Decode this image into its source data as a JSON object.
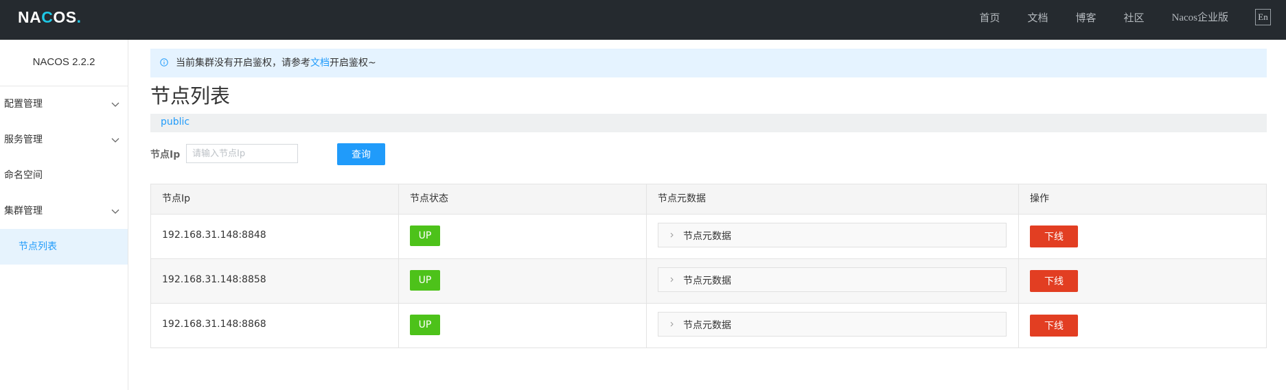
{
  "header": {
    "logo": {
      "part1": "NA",
      "part2": "C",
      "part3": "OS",
      "part4": "."
    },
    "nav": [
      "首页",
      "文档",
      "博客",
      "社区",
      "Nacos企业版"
    ],
    "lang_button": "En"
  },
  "sidebar": {
    "version": "NACOS 2.2.2",
    "items": [
      {
        "label": "配置管理",
        "icon": "chevron-down-icon"
      },
      {
        "label": "服务管理",
        "icon": "chevron-down-icon"
      },
      {
        "label": "命名空间"
      },
      {
        "label": "集群管理",
        "icon": "chevron-down-icon"
      }
    ],
    "active_sub_item": "节点列表"
  },
  "notice": {
    "icon": "info-icon",
    "text_before": "当前集群没有开启鉴权，请参考",
    "link": "文档",
    "text_after": "开启鉴权~"
  },
  "page_title": "节点列表",
  "namespace": "public",
  "search": {
    "label": "节点Ip",
    "placeholder": "请输入节点Ip",
    "value": "",
    "button": "查询"
  },
  "table": {
    "headers": [
      "节点Ip",
      "节点状态",
      "节点元数据",
      "操作"
    ],
    "rows": [
      {
        "ip": "192.168.31.148:8848",
        "status": "UP",
        "metadata": "节点元数据",
        "action": "下线"
      },
      {
        "ip": "192.168.31.148:8858",
        "status": "UP",
        "metadata": "节点元数据",
        "action": "下线"
      },
      {
        "ip": "192.168.31.148:8868",
        "status": "UP",
        "metadata": "节点元数据",
        "action": "下线"
      }
    ]
  },
  "colors": {
    "header_bg": "#252a2f",
    "accent": "#209bfa",
    "status_up": "#4dc21a",
    "danger": "#e23e22",
    "notice_bg": "#e5f3ff"
  }
}
